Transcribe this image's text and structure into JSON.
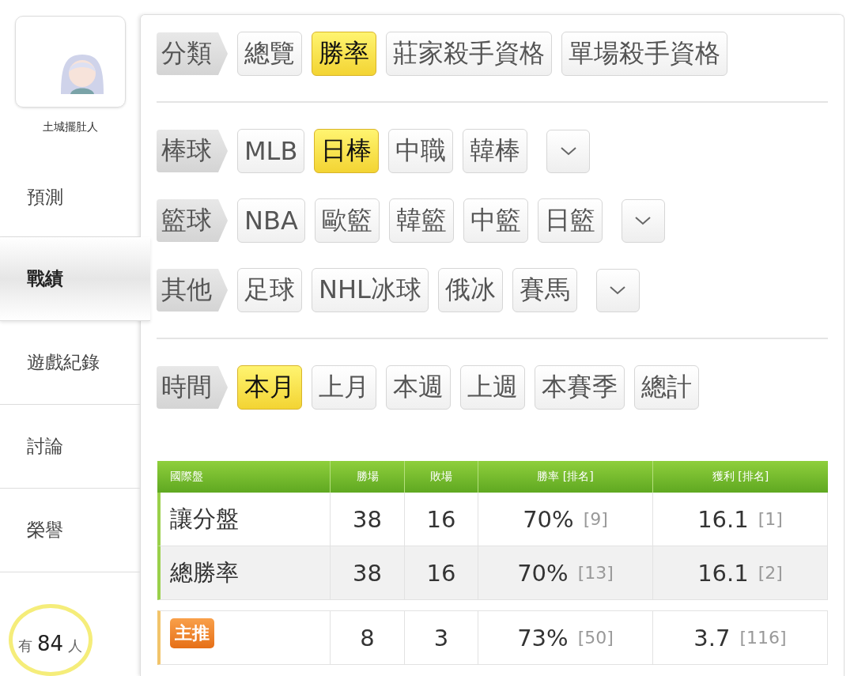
{
  "user": {
    "name": "土城擺肚人"
  },
  "nav": [
    {
      "label": "預測",
      "selected": false
    },
    {
      "label": "戰績",
      "selected": true
    },
    {
      "label": "遊戲紀錄",
      "selected": false
    },
    {
      "label": "討論",
      "selected": false
    },
    {
      "label": "榮譽",
      "selected": false
    }
  ],
  "counter": {
    "prefix": "有",
    "value": "84",
    "suffix": "人"
  },
  "sections": [
    [
      {
        "label": "分類",
        "dropdown": false,
        "options": [
          {
            "label": "總覽",
            "selected": false
          },
          {
            "label": "勝率",
            "selected": true
          },
          {
            "label": "莊家殺手資格",
            "selected": false
          },
          {
            "label": "單場殺手資格",
            "selected": false
          }
        ]
      }
    ],
    [
      {
        "label": "棒球",
        "dropdown": true,
        "options": [
          {
            "label": "MLB",
            "selected": false
          },
          {
            "label": "日棒",
            "selected": true
          },
          {
            "label": "中職",
            "selected": false
          },
          {
            "label": "韓棒",
            "selected": false
          }
        ]
      },
      {
        "label": "籃球",
        "dropdown": true,
        "options": [
          {
            "label": "NBA",
            "selected": false
          },
          {
            "label": "歐籃",
            "selected": false
          },
          {
            "label": "韓籃",
            "selected": false
          },
          {
            "label": "中籃",
            "selected": false
          },
          {
            "label": "日籃",
            "selected": false
          }
        ]
      },
      {
        "label": "其他",
        "dropdown": true,
        "options": [
          {
            "label": "足球",
            "selected": false
          },
          {
            "label": "NHL冰球",
            "selected": false
          },
          {
            "label": "俄冰",
            "selected": false
          },
          {
            "label": "賽馬",
            "selected": false
          }
        ]
      }
    ],
    [
      {
        "label": "時間",
        "dropdown": false,
        "options": [
          {
            "label": "本月",
            "selected": true
          },
          {
            "label": "上月",
            "selected": false
          },
          {
            "label": "本週",
            "selected": false
          },
          {
            "label": "上週",
            "selected": false
          },
          {
            "label": "本賽季",
            "selected": false
          },
          {
            "label": "總計",
            "selected": false
          }
        ]
      }
    ]
  ],
  "table": {
    "columns": [
      "國際盤",
      "勝場",
      "敗場",
      "勝率 [排名]",
      "獲利 [排名]"
    ],
    "rows": [
      {
        "kind": "plain",
        "name": "讓分盤",
        "wins": "38",
        "losses": "16",
        "rate": "70%",
        "rate_rank": "[9]",
        "profit": "16.1",
        "profit_rank": "[1]"
      },
      {
        "kind": "plain",
        "name": "總勝率",
        "wins": "38",
        "losses": "16",
        "rate": "70%",
        "rate_rank": "[13]",
        "profit": "16.1",
        "profit_rank": "[2]"
      },
      {
        "kind": "badge",
        "name": "主推",
        "wins": "8",
        "losses": "3",
        "rate": "73%",
        "rate_rank": "[50]",
        "profit": "3.7",
        "profit_rank": "[116]"
      }
    ]
  }
}
